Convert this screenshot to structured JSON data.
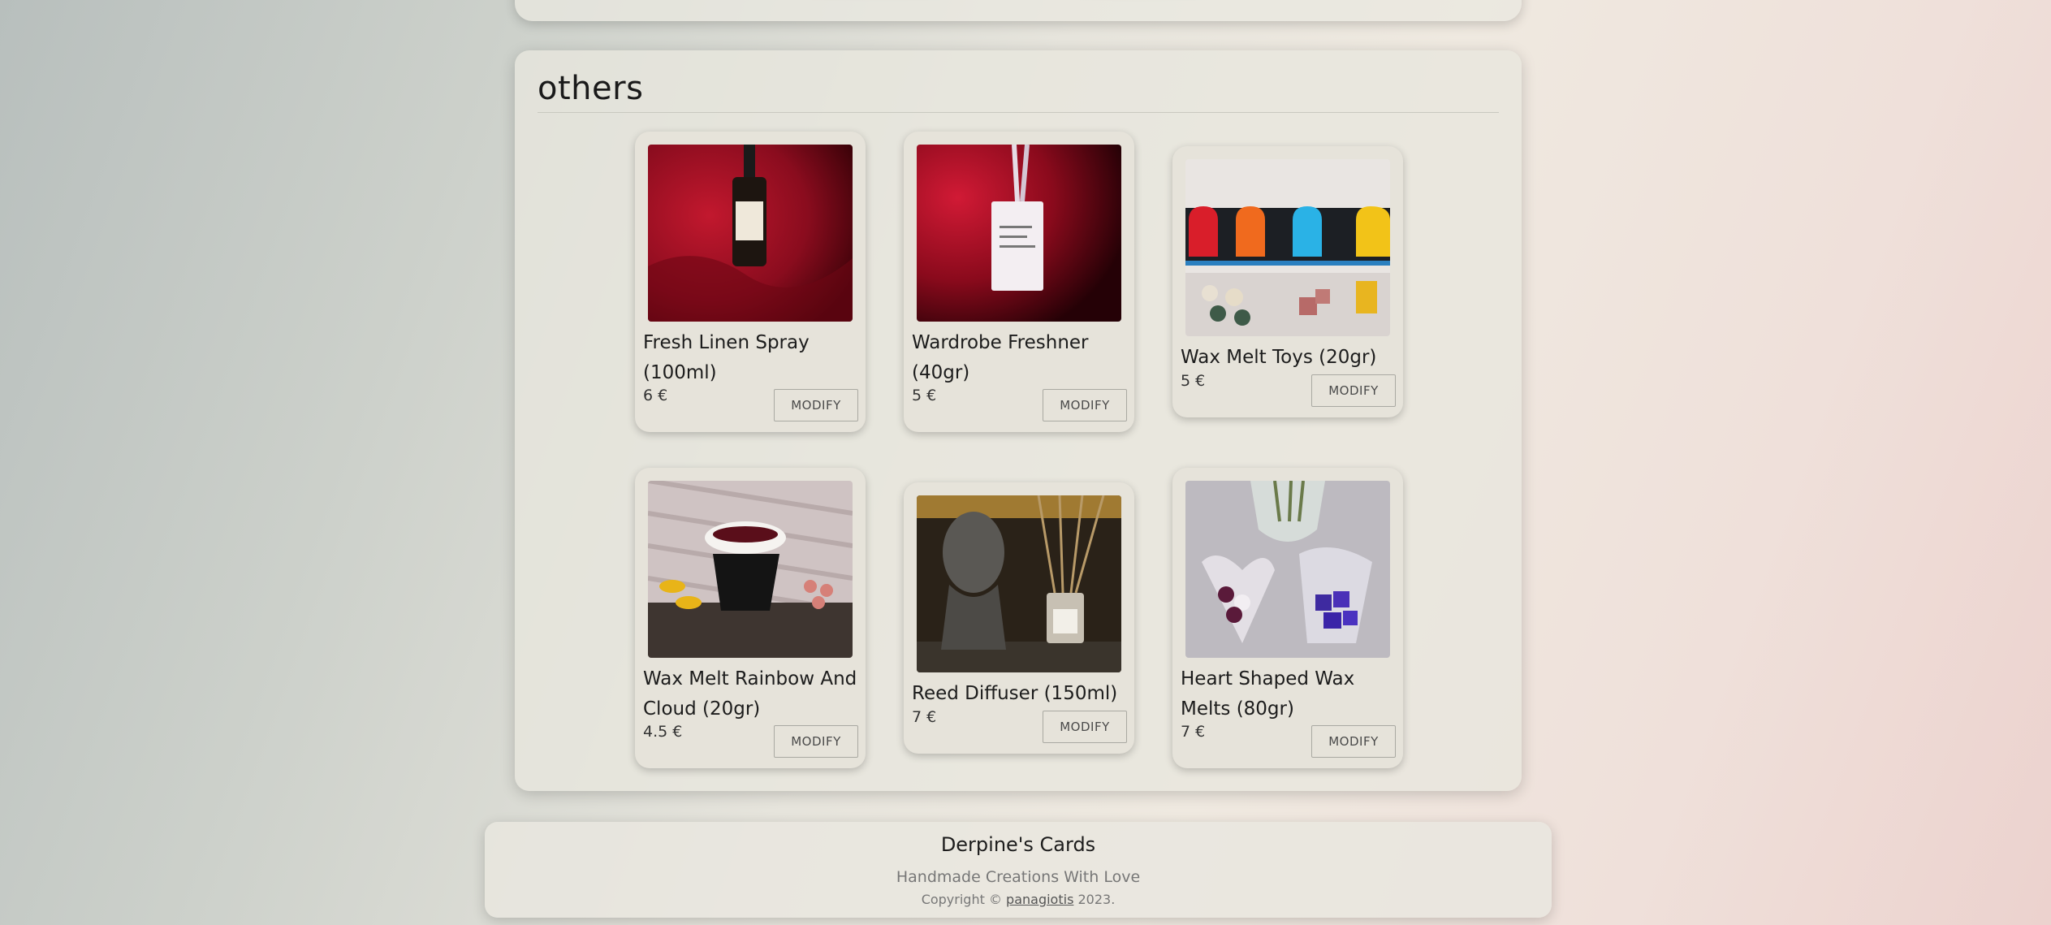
{
  "section": {
    "title": "others"
  },
  "products": [
    {
      "name": "Fresh Linen Spray (100ml)",
      "price": "6 €",
      "button": "MODIFY",
      "image": "linen-spray-photo"
    },
    {
      "name": "Wardrobe Freshner (40gr)",
      "price": "5 €",
      "button": "MODIFY",
      "image": "wardrobe-freshner-photo"
    },
    {
      "name": "Wax Melt Toys (20gr)",
      "price": "5 €",
      "button": "MODIFY",
      "image": "wax-melt-toys-photo"
    },
    {
      "name": "Wax Melt Rainbow And Cloud (20gr)",
      "price": "4.5 €",
      "button": "MODIFY",
      "image": "rainbow-cloud-photo"
    },
    {
      "name": "Reed Diffuser (150ml)",
      "price": "7 €",
      "button": "MODIFY",
      "image": "reed-diffuser-photo"
    },
    {
      "name": "Heart Shaped Wax Melts (80gr)",
      "price": "7 €",
      "button": "MODIFY",
      "image": "heart-melts-photo"
    }
  ],
  "footer": {
    "brand": "Derpine's Cards",
    "tagline": "Handmade Creations With Love",
    "copyright_prefix": "Copyright ©",
    "author": "panagiotis",
    "year": "2023."
  }
}
